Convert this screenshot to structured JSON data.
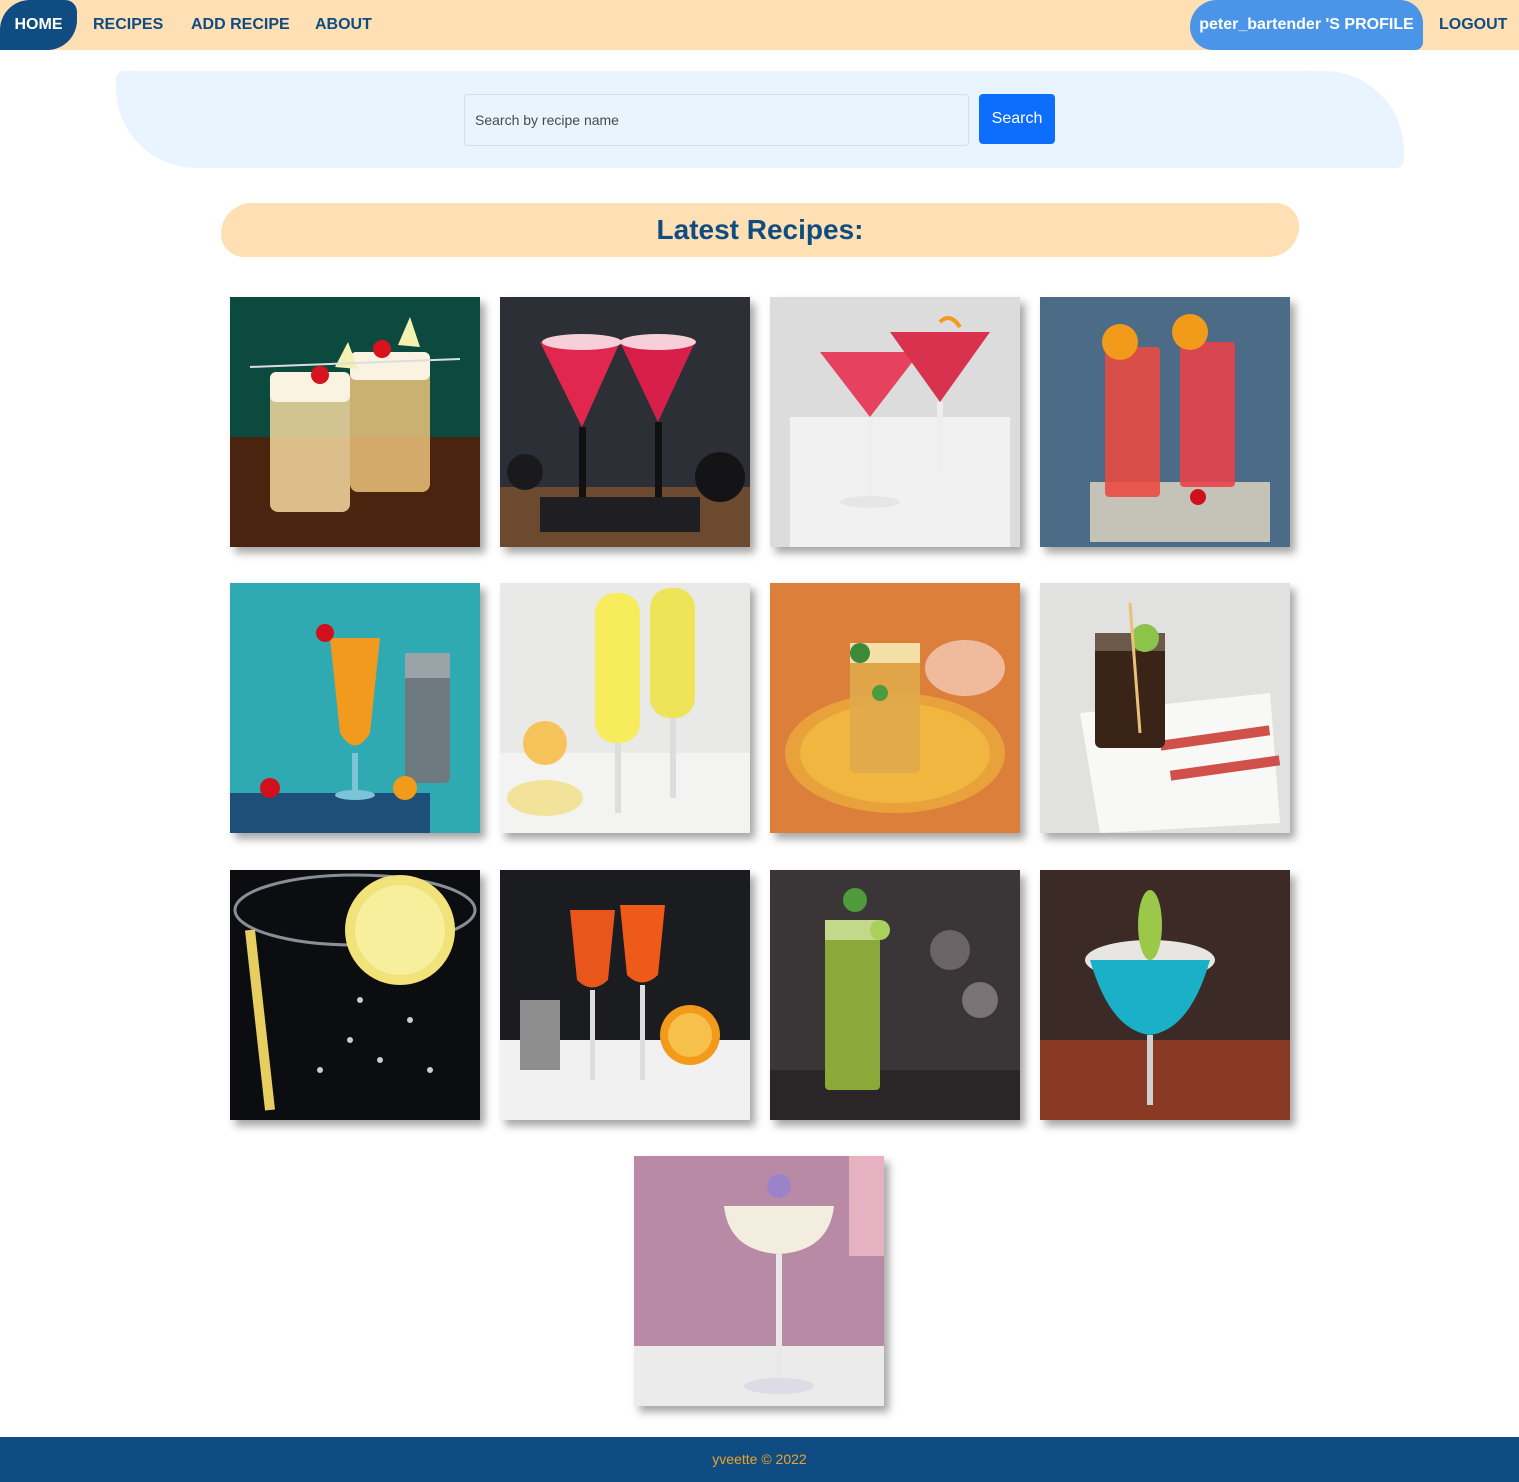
{
  "nav": {
    "home": "HOME",
    "recipes": "RECIPES",
    "add_recipe": "ADD RECIPE",
    "about": "ABOUT",
    "profile": "peter_bartender 'S PROFILE",
    "logout": "LOGOUT"
  },
  "search": {
    "placeholder": "Search by recipe name",
    "value": "",
    "button_label": "Search"
  },
  "latest": {
    "title": "Latest Recipes:"
  },
  "recipes": [
    {
      "image": "whiskey-sour-cocktail-image"
    },
    {
      "image": "red-rimmed-martini-cocktail-image"
    },
    {
      "image": "pink-cosmopolitan-cocktail-image"
    },
    {
      "image": "red-highball-orange-garnish-image"
    },
    {
      "image": "orange-hurricane-cocktail-image"
    },
    {
      "image": "mimosa-flutes-image"
    },
    {
      "image": "iced-tea-mint-cocktail-image"
    },
    {
      "image": "cola-lime-highball-image"
    },
    {
      "image": "sparkling-lemon-water-image"
    },
    {
      "image": "aperol-spritz-image"
    },
    {
      "image": "green-mojito-highball-image"
    },
    {
      "image": "blue-margarita-image"
    },
    {
      "image": "white-coupe-flower-cocktail-image"
    }
  ],
  "footer": {
    "text": "yveette © 2022"
  },
  "colors": {
    "nav_bg": "#ffdfb4",
    "nav_active": "#0f4c81",
    "profile_bg": "#4a95e8",
    "search_panel_bg": "#e9f4ff",
    "search_button": "#0d6efd",
    "footer_bg": "#0f4c81",
    "footer_text": "#f0a12a"
  }
}
